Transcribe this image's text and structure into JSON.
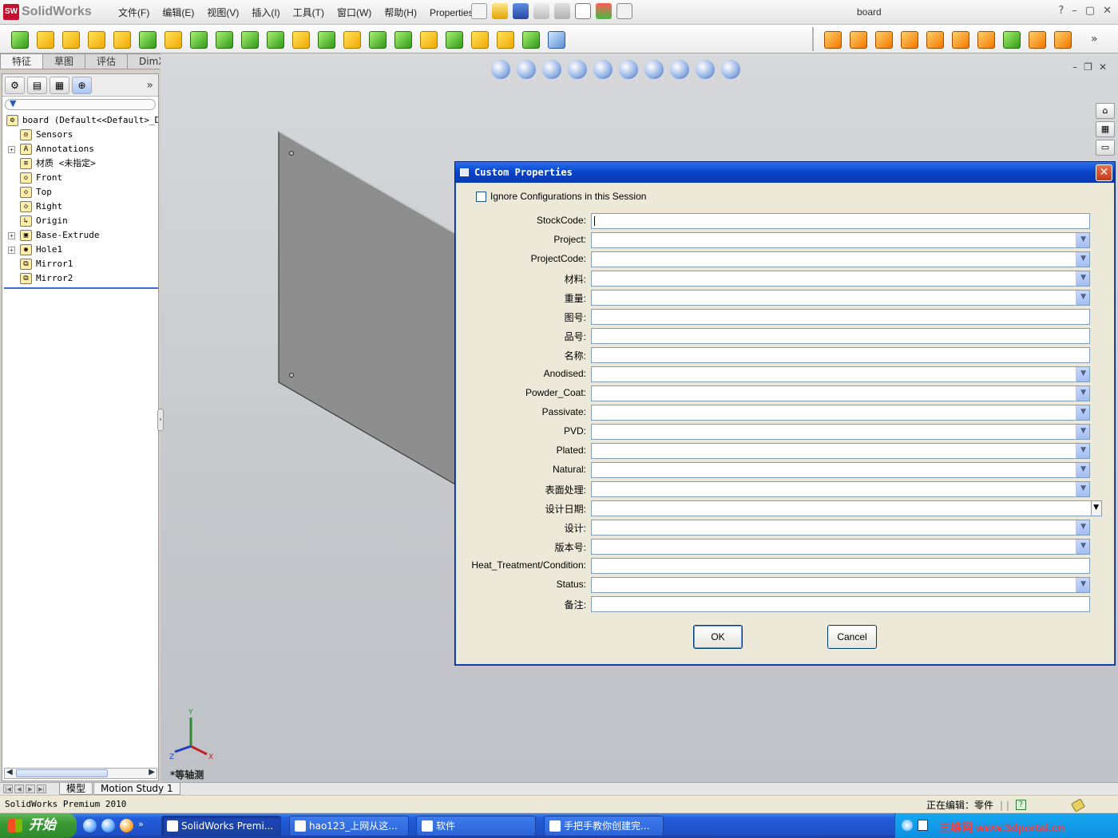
{
  "app": {
    "logo_text": "SolidWorks",
    "logo_badge": "SW",
    "document_title": "board",
    "help_glyph": "?",
    "minimize_glyph": "–",
    "restore_glyph": "▢",
    "close_glyph": "✕"
  },
  "menu": [
    "文件(F)",
    "编辑(E)",
    "视图(V)",
    "插入(I)",
    "工具(T)",
    "窗口(W)",
    "帮助(H)",
    "Properties"
  ],
  "command_manager_tabs": [
    "特征",
    "草图",
    "评估",
    "DimXpert"
  ],
  "feature_tree": {
    "more_glyph": "»",
    "filter_glyph": "▼",
    "items": [
      {
        "label": "board  (Default<<Default>_Di",
        "icon": "part-icon",
        "glyph": "⚙",
        "expand": ""
      },
      {
        "label": "Sensors",
        "icon": "sensors-icon",
        "glyph": "◎",
        "expand": ""
      },
      {
        "label": "Annotations",
        "icon": "annotations-icon",
        "glyph": "A",
        "expand": "+"
      },
      {
        "label": "材质 <未指定>",
        "icon": "material-icon",
        "glyph": "≡",
        "expand": ""
      },
      {
        "label": "Front",
        "icon": "plane-icon",
        "glyph": "◇",
        "expand": ""
      },
      {
        "label": "Top",
        "icon": "plane-icon",
        "glyph": "◇",
        "expand": ""
      },
      {
        "label": "Right",
        "icon": "plane-icon",
        "glyph": "◇",
        "expand": ""
      },
      {
        "label": "Origin",
        "icon": "origin-icon",
        "glyph": "↳",
        "expand": ""
      },
      {
        "label": "Base-Extrude",
        "icon": "extrude-icon",
        "glyph": "▣",
        "expand": "+"
      },
      {
        "label": "Hole1",
        "icon": "hole-icon",
        "glyph": "◉",
        "expand": "+"
      },
      {
        "label": "Mirror1",
        "icon": "mirror-icon",
        "glyph": "⧉",
        "expand": ""
      },
      {
        "label": "Mirror2",
        "icon": "mirror-icon",
        "glyph": "⧉",
        "expand": ""
      }
    ]
  },
  "viewport": {
    "view_label": "*等轴测",
    "triad_x": "X",
    "triad_y": "Y",
    "triad_z": "Z"
  },
  "dialog": {
    "title": "Custom Properties",
    "close_glyph": "✕",
    "ignore_label": "Ignore Configurations in this Session",
    "ignore_checked": false,
    "fields": [
      {
        "label": "StockCode:",
        "type": "text",
        "value": ""
      },
      {
        "label": "Project:",
        "type": "dropdown",
        "value": ""
      },
      {
        "label": "ProjectCode:",
        "type": "dropdown",
        "value": ""
      },
      {
        "label": "材料:",
        "type": "dropdown",
        "value": ""
      },
      {
        "label": "重量:",
        "type": "dropdown",
        "value": ""
      },
      {
        "label": "图号:",
        "type": "text",
        "value": ""
      },
      {
        "label": "品号:",
        "type": "text",
        "value": ""
      },
      {
        "label": "名称:",
        "type": "text",
        "value": ""
      },
      {
        "label": "Anodised:",
        "type": "dropdown",
        "value": ""
      },
      {
        "label": "Powder_Coat:",
        "type": "dropdown",
        "value": ""
      },
      {
        "label": "Passivate:",
        "type": "dropdown",
        "value": ""
      },
      {
        "label": "PVD:",
        "type": "dropdown",
        "value": ""
      },
      {
        "label": "Plated:",
        "type": "dropdown",
        "value": ""
      },
      {
        "label": "Natural:",
        "type": "dropdown",
        "value": ""
      },
      {
        "label": "表面处理:",
        "type": "dropdown",
        "value": ""
      },
      {
        "label": "设计日期:",
        "type": "date",
        "value": ""
      },
      {
        "label": "设计:",
        "type": "dropdown",
        "value": ""
      },
      {
        "label": "版本号:",
        "type": "dropdown",
        "value": ""
      },
      {
        "label": "Heat_Treatment/Condition:",
        "type": "text",
        "value": ""
      },
      {
        "label": "Status:",
        "type": "dropdown",
        "value": ""
      },
      {
        "label": "备注:",
        "type": "text",
        "value": ""
      }
    ],
    "ok_label": "OK",
    "cancel_label": "Cancel"
  },
  "bottom_tabs": [
    "模型",
    "Motion Study 1"
  ],
  "status": {
    "left": "SolidWorks Premium 2010",
    "editing": "正在编辑：零件"
  },
  "taskbar": {
    "start": "开始",
    "buttons": [
      {
        "label": "SolidWorks Premi...",
        "active": true
      },
      {
        "label": "hao123_上网从这...",
        "active": false
      },
      {
        "label": "软件",
        "active": false
      },
      {
        "label": "手把手教你创建完...",
        "active": false
      }
    ],
    "tray_banner": "三维网 www.3dportal.cn"
  },
  "colors": {
    "dialog_title": "#0842c8",
    "plate_face": "#8e8e8e",
    "accent_icon": "#f0a800"
  }
}
